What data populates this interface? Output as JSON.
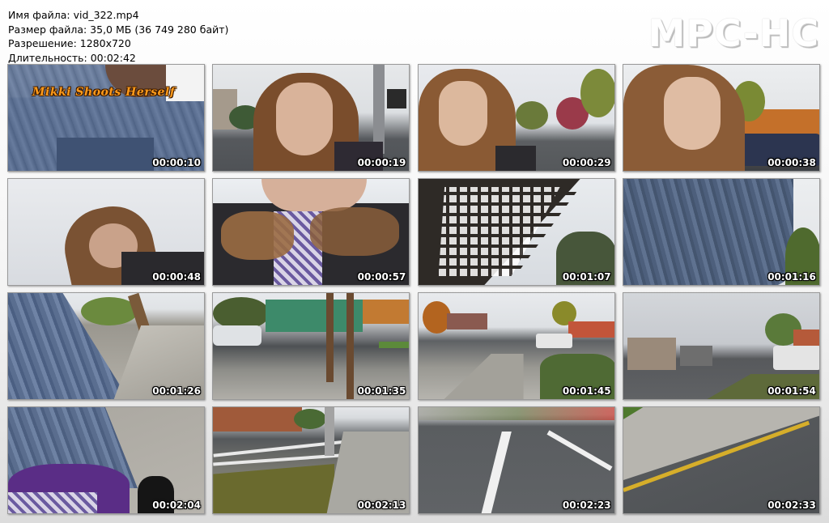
{
  "info": {
    "filename": "Имя файла: vid_322.mp4",
    "filesize": "Размер файла: 35,0 МБ (36 749 280 байт)",
    "resolution": "Разрешение: 1280x720",
    "duration": "Длительность: 00:02:42"
  },
  "logo": "MPC-HC",
  "watermark": "Mikki Shoots Herself",
  "thumbnails": [
    {
      "time": "00:00:10"
    },
    {
      "time": "00:00:19"
    },
    {
      "time": "00:00:29"
    },
    {
      "time": "00:00:38"
    },
    {
      "time": "00:00:48"
    },
    {
      "time": "00:00:57"
    },
    {
      "time": "00:01:07"
    },
    {
      "time": "00:01:16"
    },
    {
      "time": "00:01:26"
    },
    {
      "time": "00:01:35"
    },
    {
      "time": "00:01:45"
    },
    {
      "time": "00:01:54"
    },
    {
      "time": "00:02:04"
    },
    {
      "time": "00:02:13"
    },
    {
      "time": "00:02:23"
    },
    {
      "time": "00:02:33"
    }
  ],
  "colors": {
    "sky": "#dfe3e8",
    "road": "#5a5c60",
    "denim": "#5b6f8f",
    "hair": "#8a5a34",
    "jacket": "#2b2a2e",
    "watermark": "#ff9a1a"
  }
}
